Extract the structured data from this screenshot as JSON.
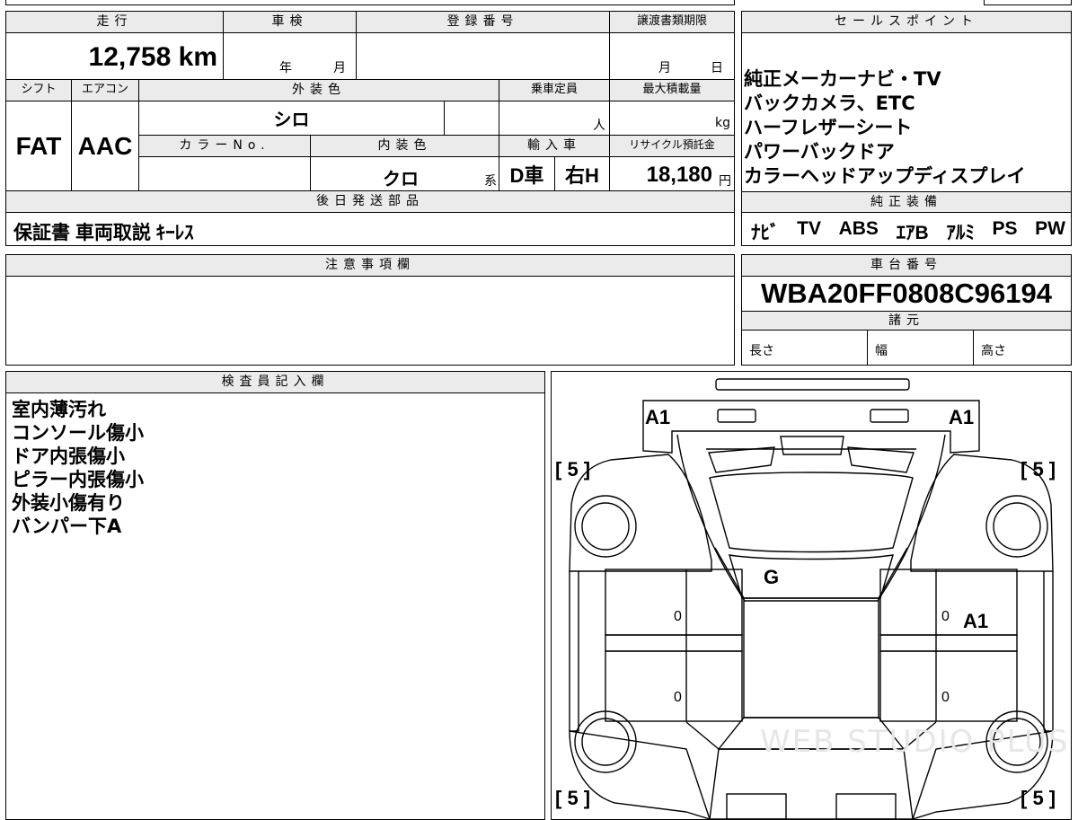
{
  "headers": {
    "mileage": "走行",
    "inspection": "車検",
    "registration": "登録番号",
    "transfer_deadline": "譲渡書類期限",
    "sales_point": "セールスポイント",
    "shift": "シフト",
    "aircon": "エアコン",
    "exterior_color": "外装色",
    "capacity": "乗車定員",
    "max_load": "最大積載量",
    "color_no": "カラーNo.",
    "interior_color": "内装色",
    "import": "輸入車",
    "recycle": "リサイクル預託金",
    "later_parts": "後日発送部品",
    "genuine_equipment": "純正装備",
    "notes": "注意事項欄",
    "chassis_no": "車台番号",
    "specs": "諸元",
    "inspector": "検査員記入欄"
  },
  "values": {
    "mileage": "12,758 km",
    "inspection_year": "年",
    "inspection_month": "月",
    "deadline_month": "月",
    "deadline_day": "日",
    "shift": "FAT",
    "aircon": "AAC",
    "exterior_color": "シロ",
    "capacity_unit": "人",
    "load_unit": "kg",
    "interior_color": "クロ",
    "interior_suffix": "系",
    "import_type": "D車",
    "handle": "右H",
    "recycle_amount": "18,180",
    "recycle_unit": "円",
    "chassis_no": "WBA20FF0808C96194",
    "length": "長さ",
    "width": "幅",
    "height": "高さ"
  },
  "sales_points": [
    "純正メーカーナビ・TV",
    "バックカメラ、ETC",
    "ハーフレザーシート",
    "パワーバックドア",
    "カラーヘッドアップディスプレイ"
  ],
  "later_parts": "保証書 車両取説 ｷｰﾚｽ",
  "equipment": [
    "ﾅﾋﾞ",
    "TV",
    "ABS",
    "ｴｱB",
    "ｱﾙﾐ",
    "PS",
    "PW"
  ],
  "inspector_notes": [
    "室内薄汚れ",
    "コンソール傷小",
    "ドア内張傷小",
    "ピラー内張傷小",
    "外装小傷有り",
    "バンパー下A"
  ],
  "diagram": {
    "front_left": "A1",
    "front_right": "A1",
    "hood": "G",
    "right_front_door": "A1",
    "tire_fl": "[ 5 ]",
    "tire_fr": "[ 5 ]",
    "tire_rl": "[ 5 ]",
    "tire_rr": "[ 5 ]",
    "door_lf": "0",
    "door_lr": "0",
    "door_rf": "0",
    "door_rr": "0",
    "watermark": "WEB STUDIO PLUS"
  }
}
